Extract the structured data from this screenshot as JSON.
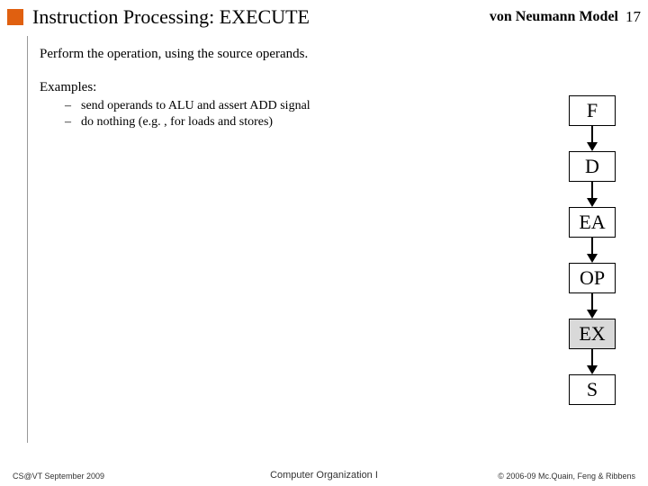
{
  "header": {
    "title": "Instruction Processing: EXECUTE",
    "subtitle": "von Neumann Model",
    "page": "17"
  },
  "body": {
    "perform": "Perform the operation, using the source operands.",
    "examples_label": "Examples:",
    "examples": [
      "send operands to ALU and assert ADD signal",
      "do nothing (e.g. , for loads and stores)"
    ]
  },
  "pipeline": {
    "stages": [
      "F",
      "D",
      "EA",
      "OP",
      "EX",
      "S"
    ],
    "active": "EX"
  },
  "footer": {
    "left": "CS@VT September 2009",
    "center": "Computer Organization I",
    "right": "© 2006-09 Mc.Quain, Feng & Ribbens"
  }
}
